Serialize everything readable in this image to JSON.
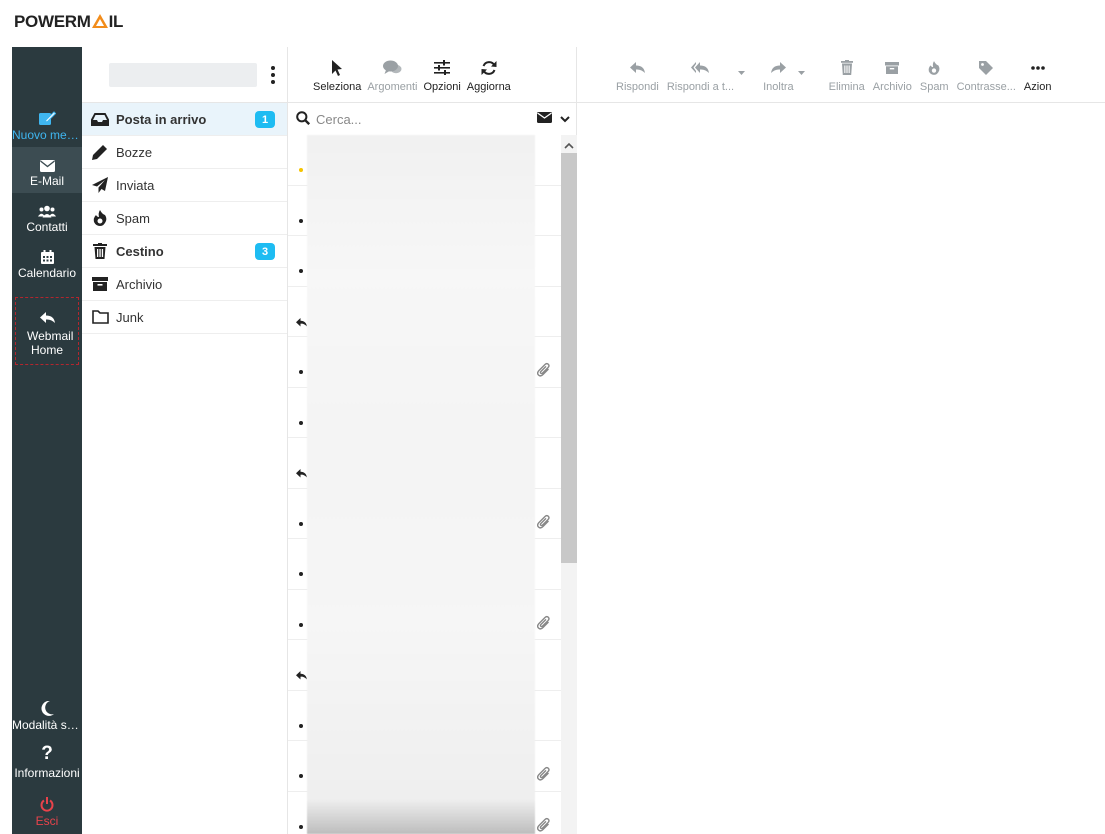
{
  "brand": {
    "logo_prefix": "POWERM",
    "logo_suffix": "IL"
  },
  "nav": {
    "compose": "Nuovo mes...",
    "email": "E-Mail",
    "contacts": "Contatti",
    "calendar": "Calendario",
    "webmail_home": "Webmail Home",
    "dark_mode": "Modalità sc...",
    "info": "Informazioni",
    "exit": "Esci"
  },
  "folders": [
    {
      "label": "Posta in arrivo",
      "icon": "inbox-icon",
      "badge": "1",
      "bold": true,
      "active": true
    },
    {
      "label": "Bozze",
      "icon": "pencil-icon"
    },
    {
      "label": "Inviata",
      "icon": "paper-plane-icon"
    },
    {
      "label": "Spam",
      "icon": "fire-icon"
    },
    {
      "label": "Cestino",
      "icon": "trash-icon",
      "badge": "3",
      "bold": true
    },
    {
      "label": "Archivio",
      "icon": "archive-icon"
    },
    {
      "label": "Junk",
      "icon": "folder-icon"
    }
  ],
  "list_toolbar": {
    "select": "Seleziona",
    "threads": "Argomenti",
    "options": "Opzioni",
    "refresh": "Aggiorna"
  },
  "search": {
    "placeholder": "Cerca..."
  },
  "message_toolbar": {
    "reply": "Rispondi",
    "reply_all": "Rispondi a t...",
    "forward": "Inoltra",
    "delete": "Elimina",
    "archive": "Archivio",
    "spam": "Spam",
    "tag": "Contrasse...",
    "more": "Azion"
  },
  "colors": {
    "rail": "#2b3a3f",
    "accent": "#1ebcf2",
    "exit": "#e8434b",
    "logo_accent": "#f28c1a"
  }
}
